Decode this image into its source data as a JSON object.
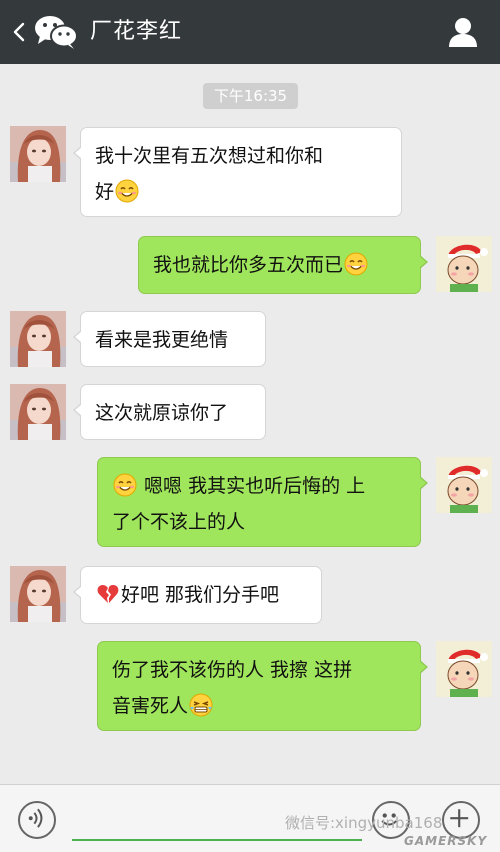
{
  "header": {
    "title": "厂花李红"
  },
  "timestamp": "下午16:35",
  "messages": [
    {
      "lines": [
        "我十次里有五次想过和你和",
        "好"
      ]
    },
    {
      "text": "我也就比你多五次而已"
    },
    {
      "text": "看来是我更绝情"
    },
    {
      "text": "这次就原谅你了"
    },
    {
      "line1": "嗯嗯  我其实也听后悔的 上",
      "line2": "了个不该上的人"
    },
    {
      "text": "好吧 那我们分手吧"
    },
    {
      "lines": [
        "伤了我不该伤的人 我擦 这拼",
        "音害死人"
      ]
    }
  ],
  "watermark": "微信号:xingyunba168",
  "brand": "GAMERSKY",
  "colors": {
    "header": "#34393c",
    "incoming_bubble": "#ffffff",
    "outgoing_bubble": "#a0e65c",
    "background": "#ebebeb"
  },
  "icons": {
    "smile": "smile-emoji",
    "broken_heart": "broken-heart-emoji",
    "grin": "grin-emoji"
  }
}
